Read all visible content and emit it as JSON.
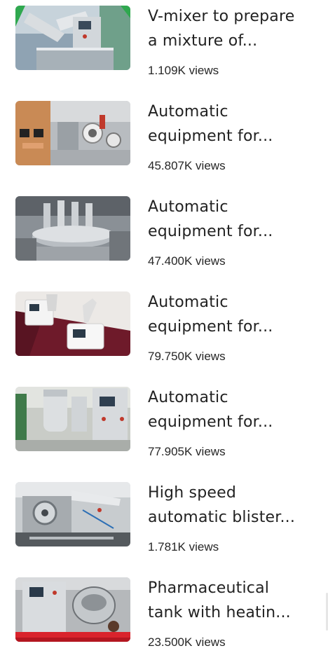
{
  "videos": [
    {
      "title_line1": "V-mixer to prepare",
      "title_line2": "a mixture of...",
      "views": "1.109K views",
      "thumbnail": "v-mixer-machine-thumbnail"
    },
    {
      "title_line1": "Automatic",
      "title_line2": "equipment for...",
      "views": "45.807K views",
      "thumbnail": "capsule-filling-machine-thumbnail"
    },
    {
      "title_line1": "Automatic",
      "title_line2": "equipment for...",
      "views": "47.400K views",
      "thumbnail": "rotary-tablet-machine-thumbnail"
    },
    {
      "title_line1": "Automatic",
      "title_line2": "equipment for...",
      "views": "79.750K views",
      "thumbnail": "lab-testing-devices-thumbnail"
    },
    {
      "title_line1": "Automatic",
      "title_line2": "equipment for...",
      "views": "77.905K views",
      "thumbnail": "fluid-bed-dryer-thumbnail"
    },
    {
      "title_line1": "High speed",
      "title_line2": "automatic blister...",
      "views": "1.781K views",
      "thumbnail": "blister-packing-machine-thumbnail"
    },
    {
      "title_line1": "Pharmaceutical",
      "title_line2": "tank with heatin...",
      "views": "23.500K views",
      "thumbnail": "heating-tank-thumbnail"
    }
  ]
}
